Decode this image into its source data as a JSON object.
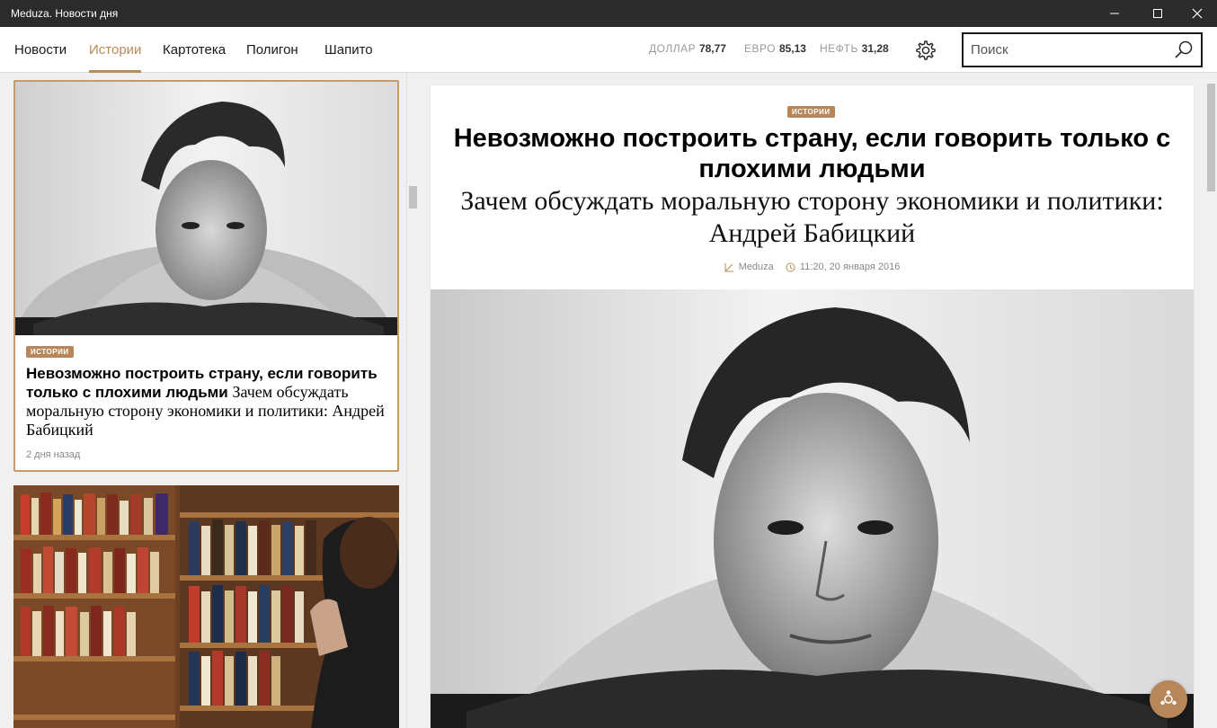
{
  "window": {
    "title": "Meduza. Новости дня"
  },
  "nav": {
    "tabs": [
      {
        "label": "Новости"
      },
      {
        "label": "Истории",
        "active": true
      },
      {
        "label": "Картотека"
      },
      {
        "label": "Полигон"
      },
      {
        "label": "Шапито"
      }
    ]
  },
  "rates": {
    "dollar_label": "ДОЛЛАР",
    "dollar_value": "78,77",
    "euro_label": "ЕВРО",
    "euro_value": "85,13",
    "oil_label": "НЕФТЬ",
    "oil_value": "31,28"
  },
  "search": {
    "placeholder": "Поиск"
  },
  "list": {
    "card1": {
      "badge": "ИСТОРИИ",
      "title_bold": "Невозможно построить страну, если говорить только с плохими людьми",
      "title_serif": "Зачем обсуждать моральную сторону экономики и политики: Андрей Бабицкий",
      "time": "2 дня назад"
    }
  },
  "article": {
    "badge": "ИСТОРИИ",
    "title": "Невозможно построить страну, если говорить только с плохими людьми",
    "subtitle": "Зачем обсуждать моральную сторону экономики и политики: Андрей Бабицкий",
    "source": "Meduza",
    "datetime": "11:20, 20 января 2016"
  },
  "colors": {
    "accent": "#b88b58",
    "titlebar": "#2b2b2b"
  },
  "icons": {
    "settings": "gear-icon",
    "search": "search-icon",
    "share": "share-icon"
  }
}
